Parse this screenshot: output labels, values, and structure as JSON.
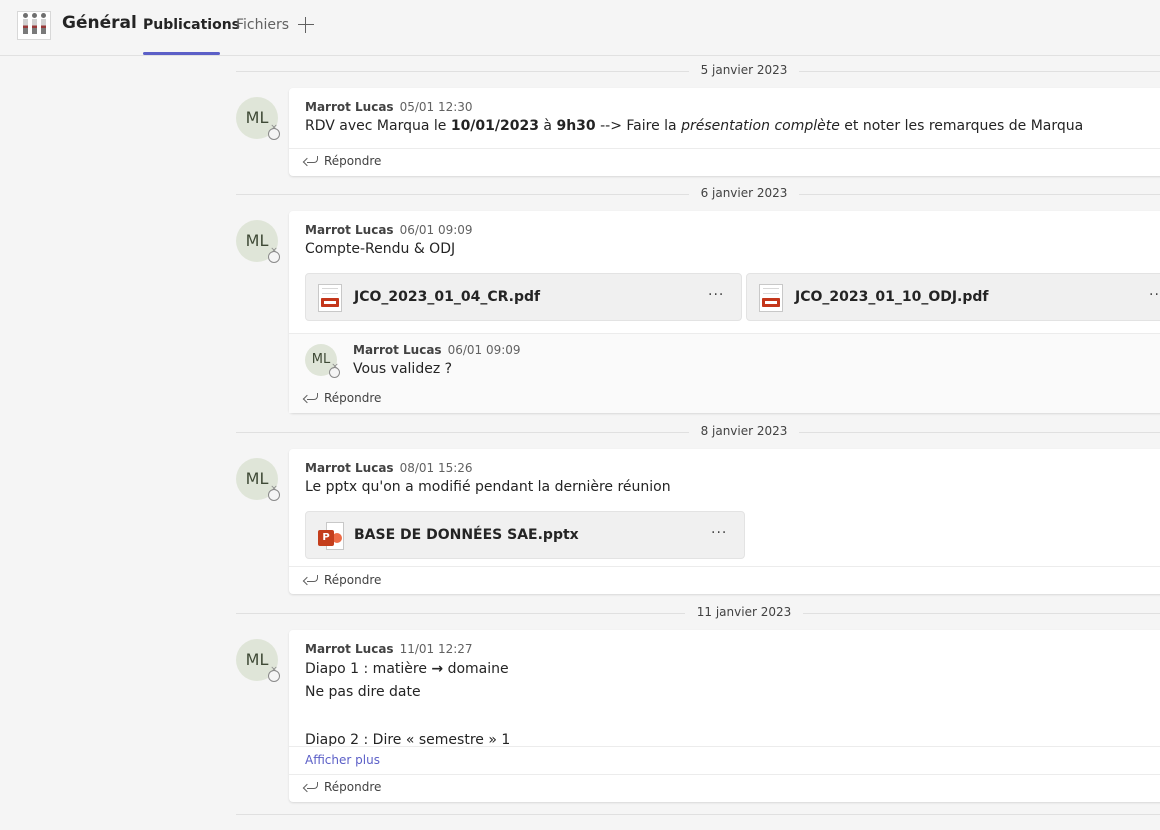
{
  "header": {
    "channel_title": "Général",
    "tabs": [
      {
        "label": "Publications"
      },
      {
        "label": "Fichiers"
      }
    ]
  },
  "dividers": [
    "5 janvier 2023",
    "6 janvier 2023",
    "8 janvier 2023",
    "11 janvier 2023"
  ],
  "reply_label": "Répondre",
  "avatar_initials": "ML",
  "posts": [
    {
      "author": "Marrot Lucas",
      "time": "05/01 12:30",
      "text_parts": {
        "p1": "RDV avec Marqua le ",
        "b1": "10/01/2023",
        "p2": " à ",
        "b2": "9h30",
        "p3": " --> Faire la ",
        "i1": "présentation complète",
        "p4": " et noter les remarques de Marqua"
      }
    },
    {
      "author": "Marrot Lucas",
      "time": "06/01 09:09",
      "text": "Compte-Rendu & ODJ",
      "attachments": [
        {
          "name": "JCO_2023_01_04_CR.pdf",
          "type": "pdf"
        },
        {
          "name": "JCO_2023_01_10_ODJ.pdf",
          "type": "pdf"
        }
      ],
      "reply": {
        "author": "Marrot Lucas",
        "time": "06/01 09:09",
        "text": "Vous validez ?"
      }
    },
    {
      "author": "Marrot Lucas",
      "time": "08/01 15:26",
      "text": "Le pptx qu'on a modifié pendant la dernière réunion",
      "attachments": [
        {
          "name": "BASE DE DONNÉES SAE.pptx",
          "type": "pptx"
        }
      ]
    },
    {
      "author": "Marrot Lucas",
      "time": "11/01 12:27",
      "lines": {
        "l1a": "Diapo 1 : matière ",
        "l1b": "domaine",
        "l2": "Ne pas dire date",
        "l3": "Diapo 2 : Dire « semestre » 1"
      },
      "show_more": "Afficher plus"
    }
  ],
  "colors": {
    "accent": "#5b5fc7",
    "pdf_red": "#c4361b",
    "pptx_orange": "#c43e1c",
    "avatar_bg": "#dfe5d8"
  }
}
